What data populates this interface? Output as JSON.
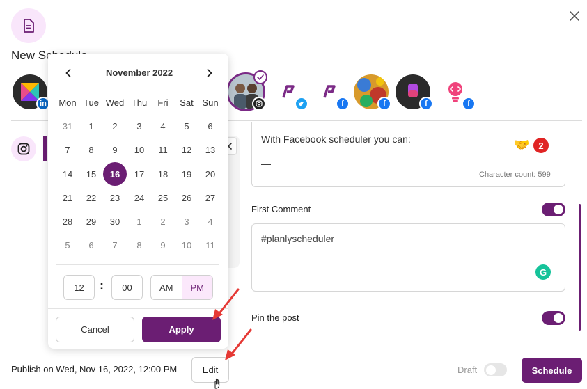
{
  "modal": {
    "title": "New Schedule"
  },
  "accounts": [
    {
      "network": "linkedin",
      "net_label": "in",
      "color": "#0a66c2",
      "selected": false
    },
    {
      "network": "instagram",
      "net_label": "ig",
      "color": "#222222",
      "selected": true
    },
    {
      "network": "twitter",
      "net_label": "t",
      "color": "#1da1f2",
      "selected": false
    },
    {
      "network": "facebook",
      "net_label": "f",
      "color": "#1877f2",
      "selected": false
    },
    {
      "network": "facebook",
      "net_label": "f",
      "color": "#1877f2",
      "selected": false
    },
    {
      "network": "facebook",
      "net_label": "f",
      "color": "#1877f2",
      "selected": false
    },
    {
      "network": "facebook",
      "net_label": "f",
      "color": "#1877f2",
      "selected": false
    }
  ],
  "editor": {
    "text": "With Facebook scheduler you can:",
    "dash": "—",
    "char_count": "Character count: 599",
    "badge": "2"
  },
  "first_comment": {
    "label": "First Comment",
    "value": "#planlyscheduler",
    "enabled": true
  },
  "pin_post": {
    "label": "Pin the post",
    "enabled": true
  },
  "footer": {
    "publish_text": "Publish on Wed, Nov 16, 2022, 12:00 PM",
    "edit_label": "Edit",
    "draft_label": "Draft",
    "schedule_label": "Schedule"
  },
  "calendar": {
    "month_label": "November 2022",
    "weekdays": [
      "Mon",
      "Tue",
      "Wed",
      "Thu",
      "Fri",
      "Sat",
      "Sun"
    ],
    "weeks": [
      [
        [
          "31",
          true
        ],
        [
          "1",
          false
        ],
        [
          "2",
          false
        ],
        [
          "3",
          false
        ],
        [
          "4",
          false
        ],
        [
          "5",
          false
        ],
        [
          "6",
          false
        ]
      ],
      [
        [
          "7",
          false
        ],
        [
          "8",
          false
        ],
        [
          "9",
          false
        ],
        [
          "10",
          false
        ],
        [
          "11",
          false
        ],
        [
          "12",
          false
        ],
        [
          "13",
          false
        ]
      ],
      [
        [
          "14",
          false
        ],
        [
          "15",
          false
        ],
        [
          "16",
          false
        ],
        [
          "17",
          false
        ],
        [
          "18",
          false
        ],
        [
          "19",
          false
        ],
        [
          "20",
          false
        ]
      ],
      [
        [
          "21",
          false
        ],
        [
          "22",
          false
        ],
        [
          "23",
          false
        ],
        [
          "24",
          false
        ],
        [
          "25",
          false
        ],
        [
          "26",
          false
        ],
        [
          "27",
          false
        ]
      ],
      [
        [
          "28",
          false
        ],
        [
          "29",
          false
        ],
        [
          "30",
          false
        ],
        [
          "1",
          true
        ],
        [
          "2",
          true
        ],
        [
          "3",
          true
        ],
        [
          "4",
          true
        ]
      ],
      [
        [
          "5",
          true
        ],
        [
          "6",
          true
        ],
        [
          "7",
          true
        ],
        [
          "8",
          true
        ],
        [
          "9",
          true
        ],
        [
          "10",
          true
        ],
        [
          "11",
          true
        ]
      ]
    ],
    "selected_day": "16",
    "hour": "12",
    "time_separator": ":",
    "minute": "00",
    "am_label": "AM",
    "pm_label": "PM",
    "period": "PM",
    "cancel_label": "Cancel",
    "apply_label": "Apply"
  },
  "colors": {
    "brand": "#6b1e73",
    "arrow": "#e53935"
  }
}
